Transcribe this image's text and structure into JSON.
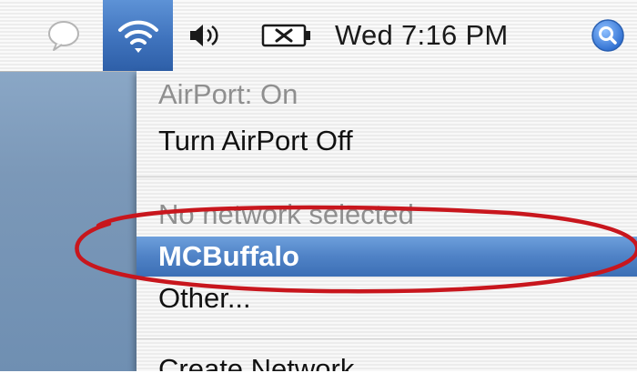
{
  "menubar": {
    "clock_text": "Wed 7:16 PM",
    "icons": [
      "chat-icon",
      "airport-wifi-icon",
      "volume-icon",
      "battery-icon",
      "spotlight-icon"
    ]
  },
  "airport_menu": {
    "status": "AirPort: On",
    "toggle_label": "Turn AirPort Off",
    "no_network": "No network selected",
    "networks": [
      "MCBuffalo"
    ],
    "selected_network": "MCBuffalo",
    "other_label": "Other...",
    "create_label": "Create Network..."
  },
  "colors": {
    "highlight": "#4f82c6",
    "annotation_red": "#c8161d"
  }
}
